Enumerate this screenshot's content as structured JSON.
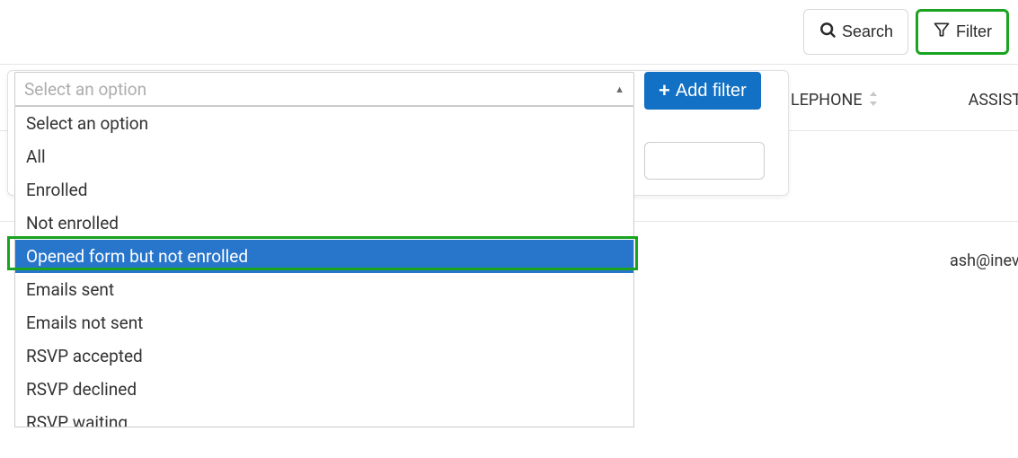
{
  "toolbar": {
    "search_label": "Search",
    "filter_label": "Filter"
  },
  "filter_actions": {
    "add_filter_label": "Add filter"
  },
  "select": {
    "placeholder": "Select an option",
    "options": [
      "Select an option",
      "All",
      "Enrolled",
      "Not enrolled",
      "Opened form but not enrolled",
      "Emails sent",
      "Emails not sent",
      "RSVP accepted",
      "RSVP declined",
      "RSVP waiting"
    ],
    "highlighted_index": 4
  },
  "columns": {
    "telephone": "LEPHONE",
    "assistant": "ASSISTAN"
  },
  "row": {
    "assistant_value": "ash@inev"
  }
}
